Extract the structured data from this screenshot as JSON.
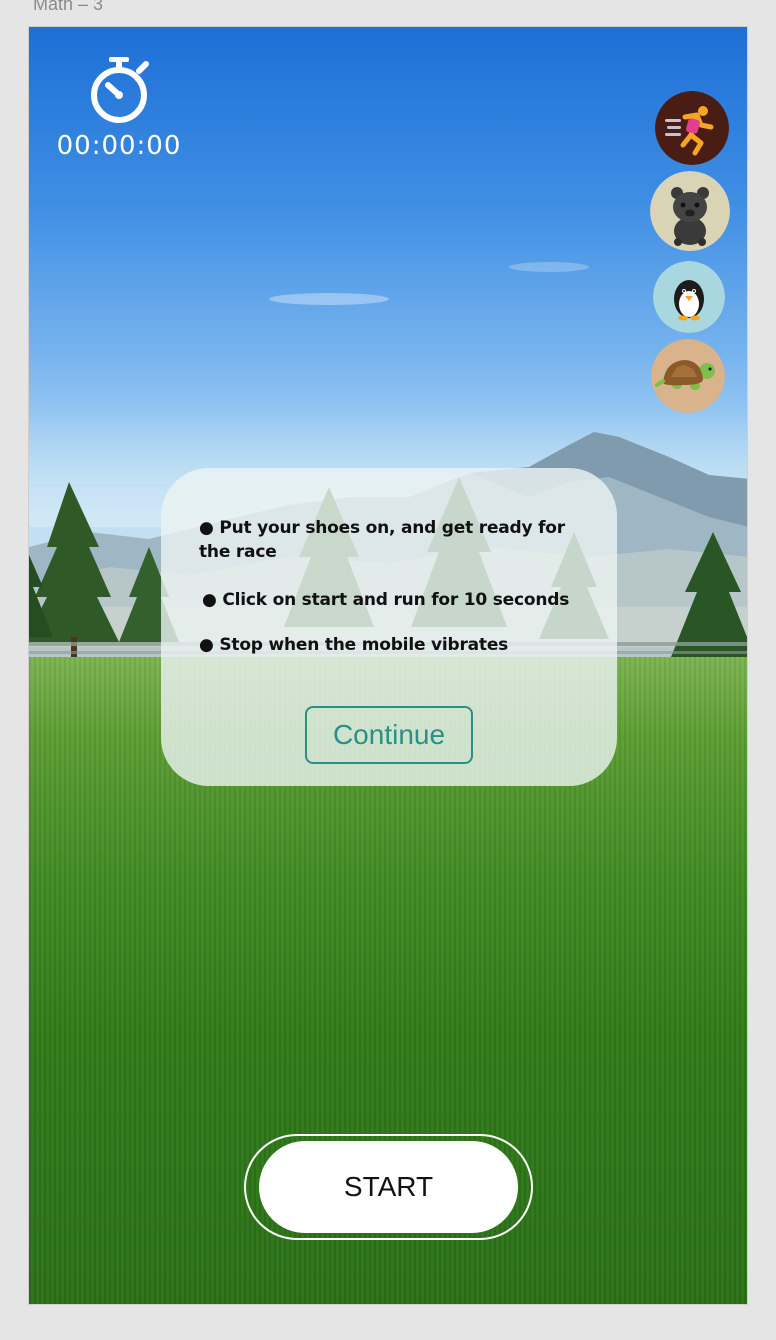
{
  "artboard_label": "Math – 3",
  "timer": {
    "icon": "stopwatch-icon",
    "value": "00:00:00"
  },
  "avatars": [
    {
      "name": "runner",
      "icon": "runner-icon",
      "bg": "#4a1d14"
    },
    {
      "name": "panther",
      "icon": "panther-icon",
      "bg": "#d9d4b5"
    },
    {
      "name": "penguin",
      "icon": "penguin-icon",
      "bg": "#a9d7df"
    },
    {
      "name": "turtle",
      "icon": "turtle-icon",
      "bg": "#d9b38c"
    }
  ],
  "instructions": {
    "line1": "● Put your shoes on, and get ready for the race",
    "line2": "● Click on start and run for 10 seconds",
    "line3": "● Stop when the mobile vibrates",
    "continue_label": "Continue"
  },
  "start_label": "START",
  "colors": {
    "accent": "#2a8f86",
    "panel": "#ecf4f3",
    "runner_bg": "#4a1d14",
    "panther_bg": "#d9d4b5",
    "penguin_bg": "#a9d7df",
    "turtle_bg": "#d9b38c"
  }
}
